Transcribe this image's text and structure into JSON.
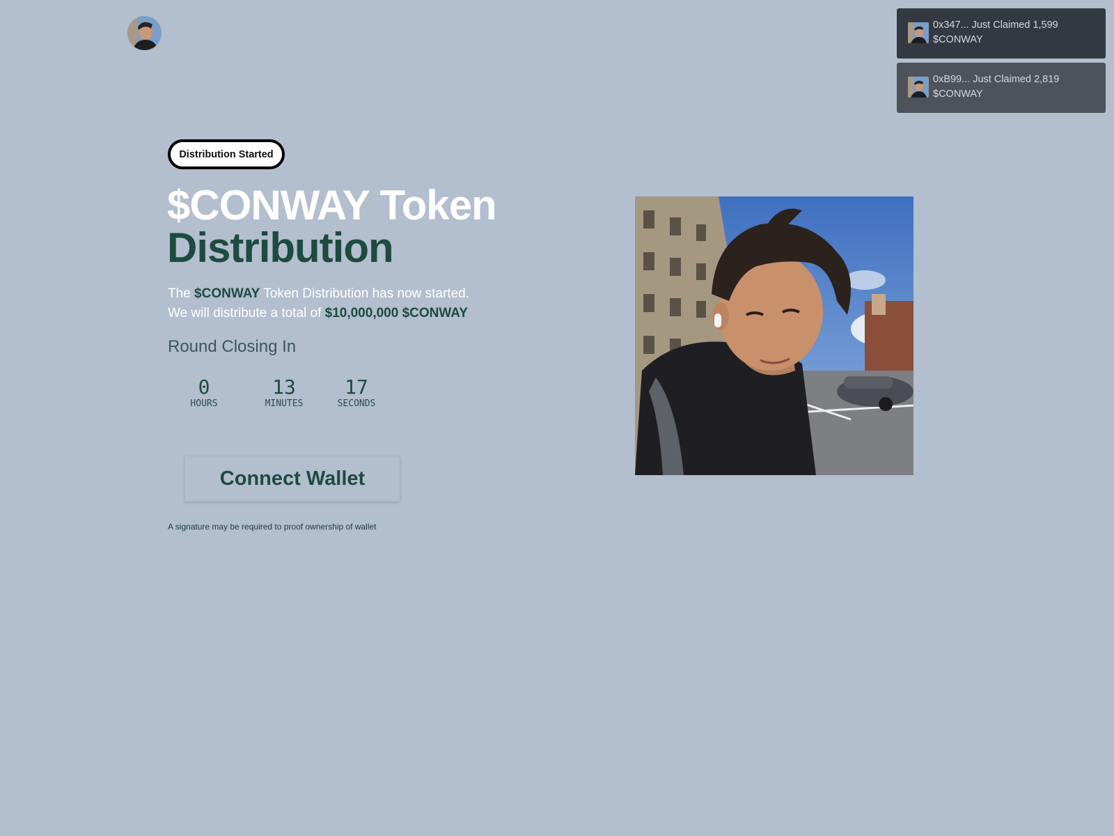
{
  "header": {
    "avatar_icon": "profile-avatar-icon"
  },
  "toasts": [
    {
      "text": "0x347... Just Claimed 1,599 $CONWAY"
    },
    {
      "text": "0xB99... Just Claimed 2,819 $CONWAY"
    }
  ],
  "badge": {
    "label": "Distribution Started"
  },
  "headline": {
    "line1": "$CONWAY Token",
    "line2": "Distribution"
  },
  "description": {
    "p1_pre": "The ",
    "p1_token": "$CONWAY",
    "p1_post": " Token Distribution has now started.",
    "p2_pre": "We will distribute a total of ",
    "p2_amount": "$10,000,000 $CONWAY"
  },
  "countdown": {
    "title": "Round Closing In",
    "hours": "0",
    "hours_label": "HOURS",
    "minutes": "13",
    "minutes_label": "MINUTES",
    "seconds": "17",
    "seconds_label": "SECONDS"
  },
  "connect": {
    "label": "Connect Wallet"
  },
  "note": "A signature may be required to proof ownership of wallet",
  "colors": {
    "background": "#b3bece",
    "accent_green": "#1d4b40",
    "toast_dark": "#343840",
    "toast_mid": "#4d525b"
  }
}
